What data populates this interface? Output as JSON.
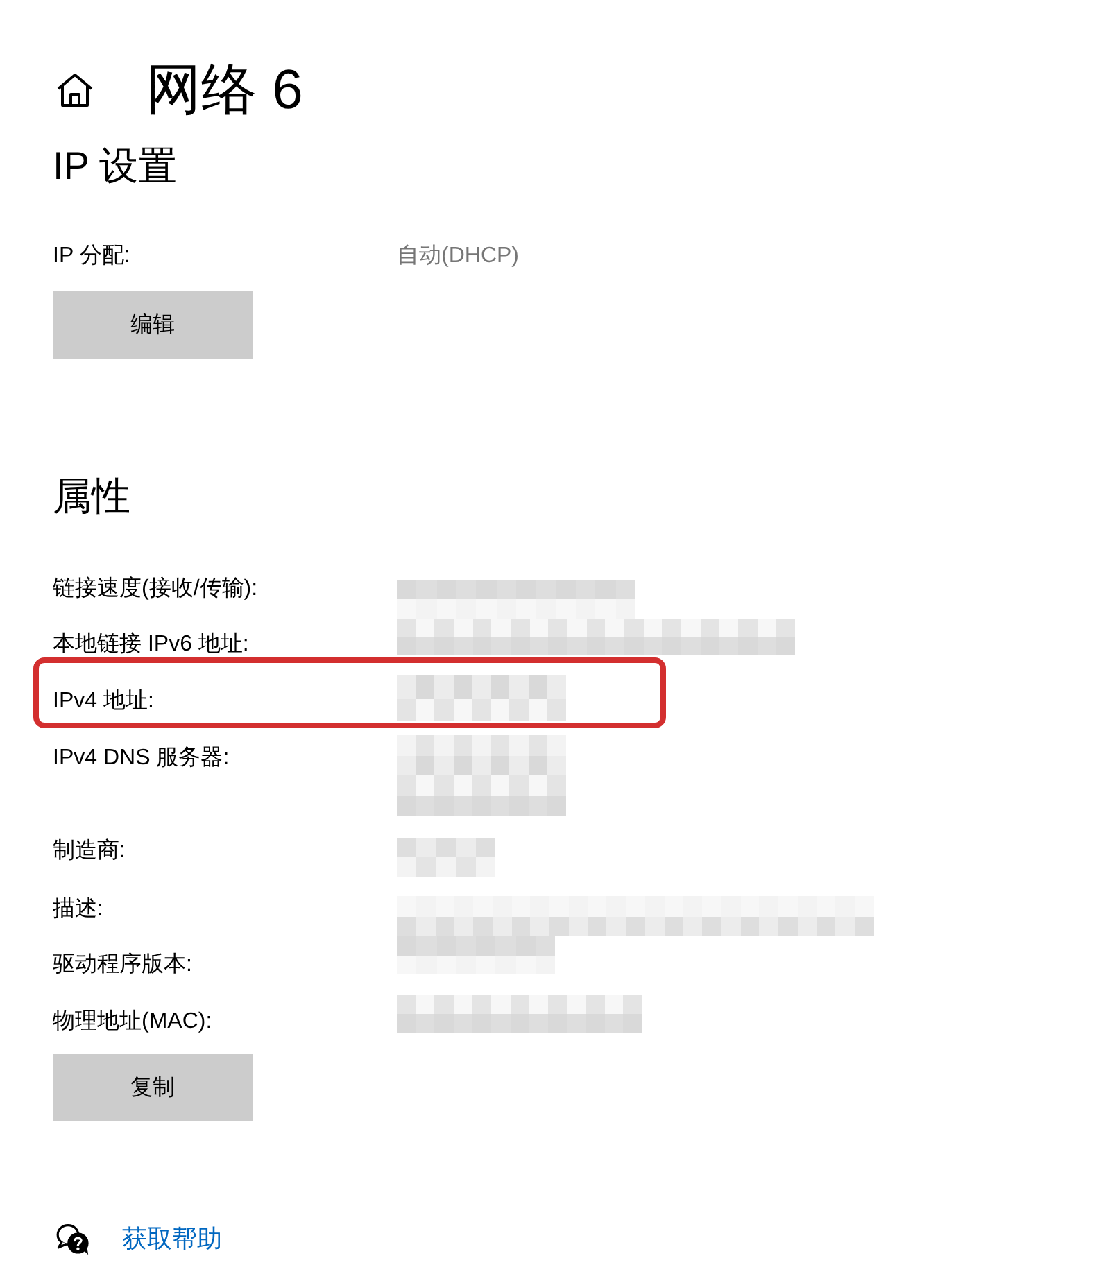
{
  "header": {
    "title": "网络 6"
  },
  "ip_settings": {
    "heading": "IP 设置",
    "assignment": {
      "label": "IP 分配:",
      "value": "自动(DHCP)"
    },
    "edit_button": "编辑"
  },
  "properties": {
    "heading": "属性",
    "rows": [
      {
        "label": "链接速度(接收/传输):",
        "redacted": true,
        "highlighted": false
      },
      {
        "label": "本地链接 IPv6 地址:",
        "redacted": true,
        "highlighted": false
      },
      {
        "label": "IPv4 地址:",
        "redacted": true,
        "highlighted": true
      },
      {
        "label": "IPv4 DNS 服务器:",
        "redacted": true,
        "highlighted": false
      },
      {
        "label": "制造商:",
        "redacted": true,
        "highlighted": false
      },
      {
        "label": "描述:",
        "redacted": true,
        "highlighted": false
      },
      {
        "label": "驱动程序版本:",
        "redacted": true,
        "highlighted": false
      },
      {
        "label": "物理地址(MAC):",
        "redacted": true,
        "highlighted": false
      }
    ],
    "copy_button": "复制"
  },
  "help": {
    "link": "获取帮助"
  }
}
